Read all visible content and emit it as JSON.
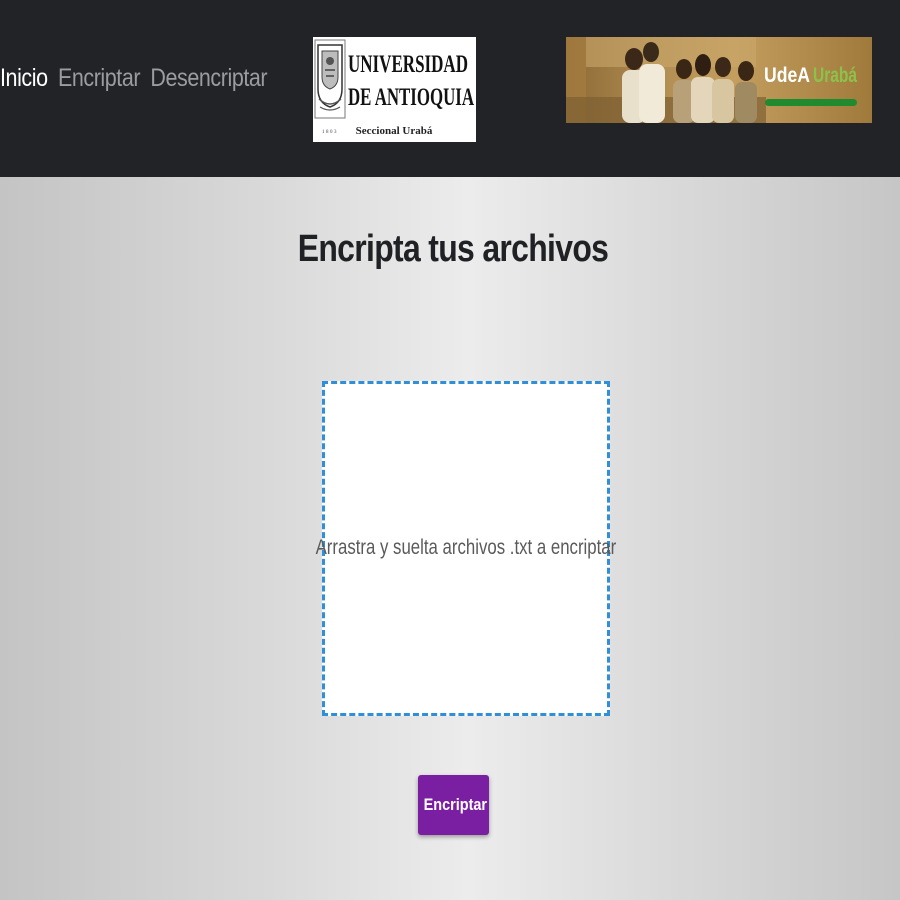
{
  "nav": {
    "links": [
      {
        "label": "Inicio",
        "active": true
      },
      {
        "label": "Encriptar",
        "active": false
      },
      {
        "label": "Desencriptar",
        "active": false
      }
    ]
  },
  "logo": {
    "line1": "UNIVERSIDAD",
    "line2": "DE ANTIOQUIA",
    "subtitle": "Seccional Urabá",
    "year": "1803"
  },
  "banner": {
    "text_white": "UdeA",
    "text_green": "Urabá",
    "accent": "#1f8a2e",
    "text_green_color": "#8bc34a"
  },
  "main": {
    "title": "Encripta tus archivos",
    "dropzone_text": "Arrastra y suelta archivos .txt a encriptar",
    "button_label": "Encriptar"
  },
  "colors": {
    "navbar": "#212327",
    "button": "#7b1fa2",
    "dropzone_border": "#2f8fd8"
  }
}
